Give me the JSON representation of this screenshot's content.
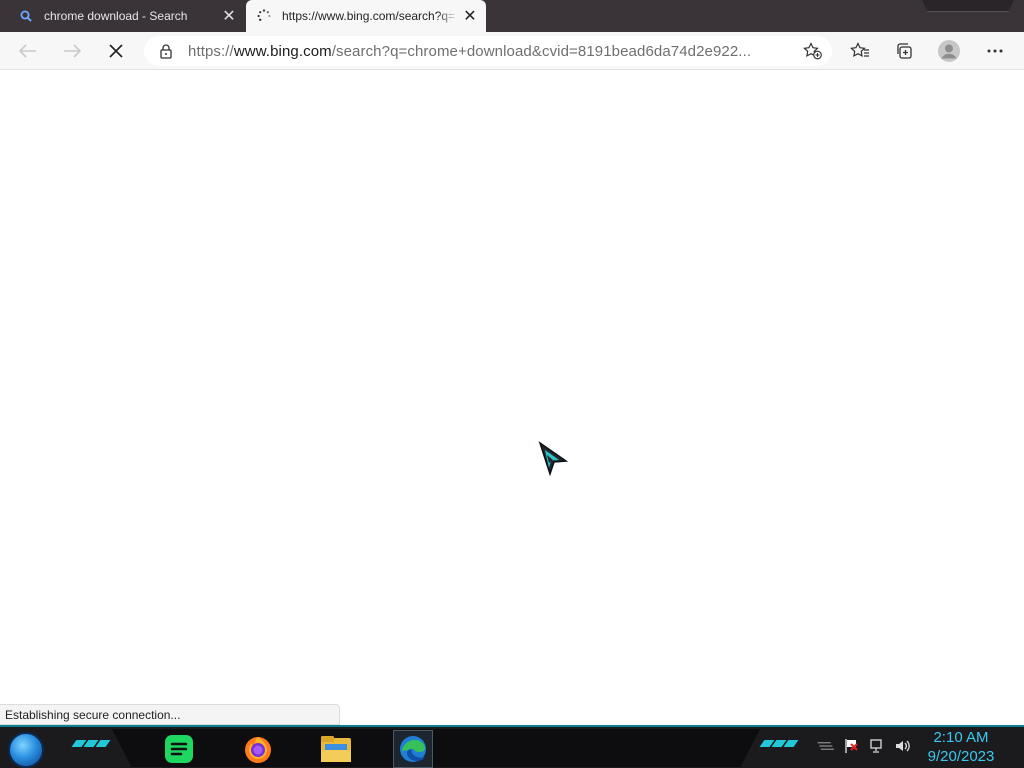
{
  "tabs": [
    {
      "title": "chrome download - Search",
      "icon": "search-icon",
      "active": false
    },
    {
      "title": "https://www.bing.com/search?q=",
      "icon": "loading-spinner-icon",
      "active": true
    }
  ],
  "addressbar": {
    "scheme": "https://",
    "host": "www.bing.com",
    "rest": "/search?q=chrome+download&cvid=8191bead6da74d2e922..."
  },
  "status_text": "Establishing secure connection...",
  "taskbar": {
    "pinned": [
      "sheets-app-icon",
      "firefox-icon",
      "file-explorer-icon",
      "edge-icon"
    ],
    "tray": [
      "action-center-flag-icon",
      "network-icon",
      "volume-icon"
    ],
    "clock": {
      "time": "2:10 AM",
      "date": "9/20/2023"
    }
  },
  "colors": {
    "accent_cyan": "#20c8d8",
    "clock_text": "#39c8f0",
    "tabstrip_bg": "#3a3338"
  }
}
